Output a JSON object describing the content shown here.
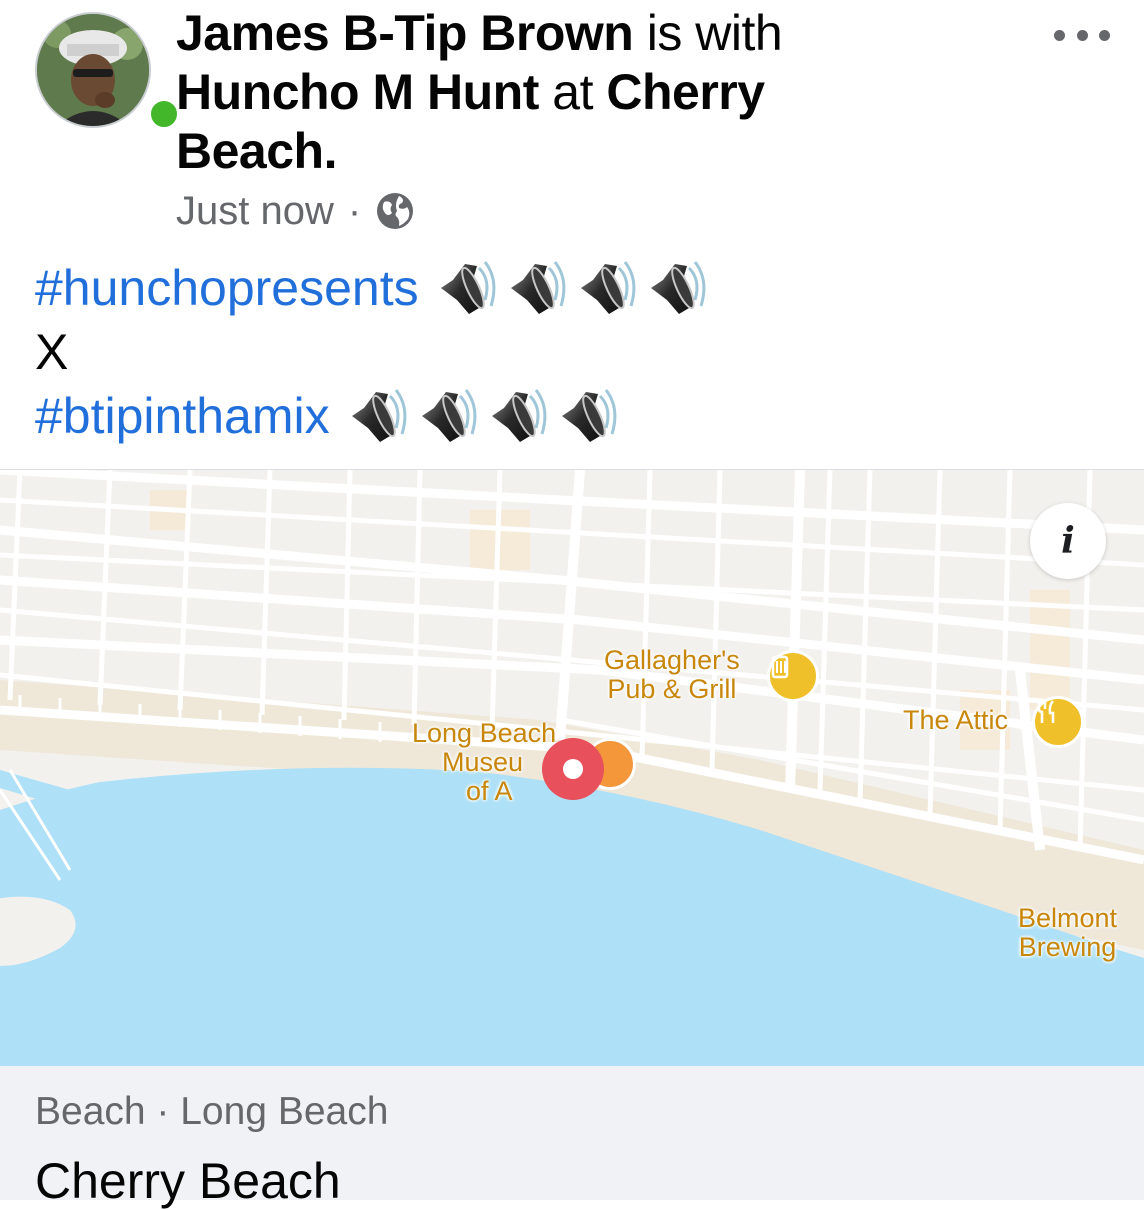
{
  "post": {
    "author": "James B-Tip Brown",
    "with_connector": "is with",
    "tagged": "Huncho M Hunt",
    "at_connector": "at",
    "location_line1": "Cherry",
    "location_line2": "Beach.",
    "timestamp": "Just now",
    "separator": "·",
    "privacy_icon": "globe-icon",
    "more_icon": "more-dots-icon",
    "online_status": "online",
    "hashtag1": "#hunchopresents",
    "connector": "X",
    "hashtag2": "#btipinthamix",
    "emoji": "speaker-high-volume-icon",
    "emoji_count_per_line": 4
  },
  "map": {
    "info_button_label": "i",
    "labels": {
      "gallaghers_line1": "Gallagher's",
      "gallaghers_line2": "Pub & Grill",
      "attic": "The Attic",
      "museum_line1": "Long Beach",
      "museum_line2": "Museu",
      "museum_line3": "of A",
      "belmont_line1": "Belmont",
      "belmont_line2": "Brewing"
    },
    "pin_icon": "location-pin-icon",
    "colors": {
      "water": "#aee0f7",
      "land": "#f3f1ee",
      "sand": "#efe8d9",
      "poi_text": "#c8860a",
      "pin": "#e8505b"
    }
  },
  "place": {
    "category": "Beach · Long Beach",
    "name": "Cherry Beach"
  },
  "colors": {
    "hashtag": "#216fdb",
    "meta_text": "#65676b",
    "online": "#42b72a"
  }
}
